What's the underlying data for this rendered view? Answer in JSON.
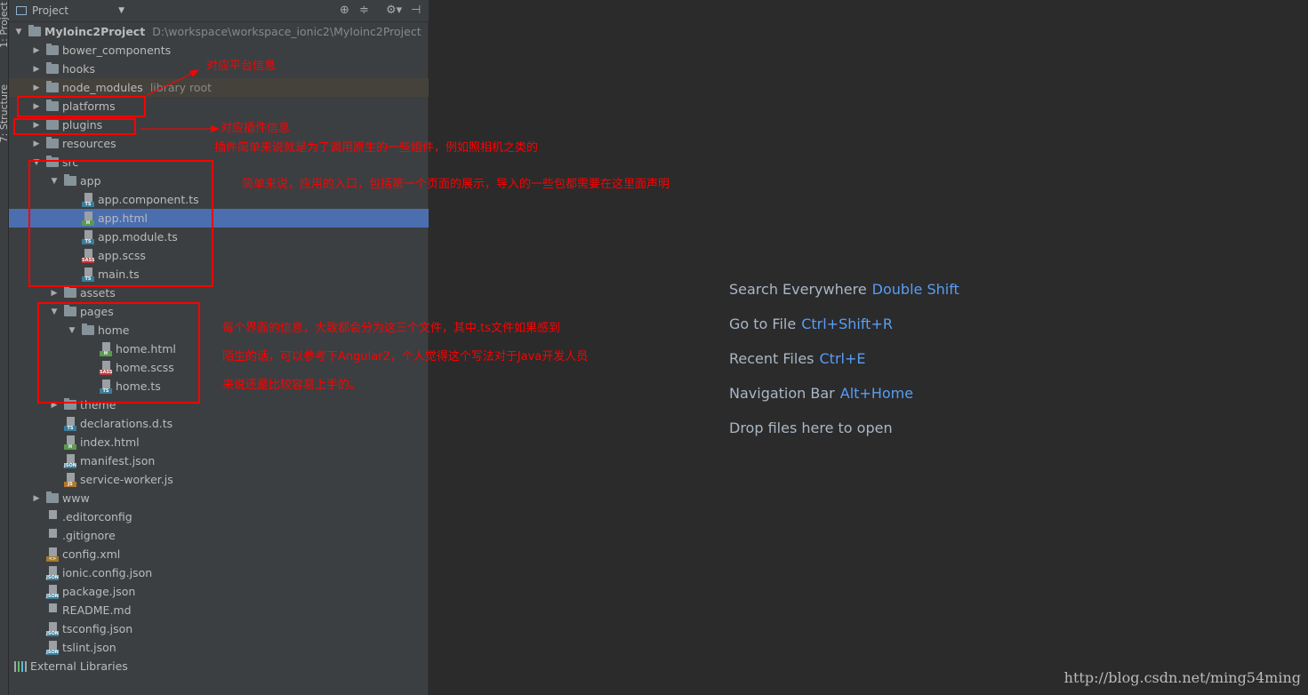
{
  "sidebar_tabs": {
    "project": "1: Project",
    "structure": "7: Structure"
  },
  "header": {
    "title": "Project"
  },
  "tree": [
    {
      "level": 0,
      "kind": "folder",
      "state": "open",
      "name": "MyIoinc2Project",
      "extra": "D:\\workspace\\workspace_ionic2\\MyIoinc2Project",
      "bold": true
    },
    {
      "level": 1,
      "kind": "folder",
      "state": "closed",
      "name": "bower_components"
    },
    {
      "level": 1,
      "kind": "folder",
      "state": "closed",
      "name": "hooks"
    },
    {
      "level": 1,
      "kind": "folder",
      "state": "closed",
      "name": "node_modules",
      "extra": "library root",
      "lib": true
    },
    {
      "level": 1,
      "kind": "folder",
      "state": "closed",
      "name": "platforms"
    },
    {
      "level": 1,
      "kind": "folder",
      "state": "closed",
      "name": "plugins"
    },
    {
      "level": 1,
      "kind": "folder",
      "state": "closed",
      "name": "resources"
    },
    {
      "level": 1,
      "kind": "folder",
      "state": "open",
      "name": "src"
    },
    {
      "level": 2,
      "kind": "folder",
      "state": "open",
      "name": "app"
    },
    {
      "level": 3,
      "kind": "file",
      "badge": "TS",
      "name": "app.component.ts"
    },
    {
      "level": 3,
      "kind": "file",
      "badge": "H",
      "name": "app.html",
      "selected": true
    },
    {
      "level": 3,
      "kind": "file",
      "badge": "TS",
      "name": "app.module.ts"
    },
    {
      "level": 3,
      "kind": "file",
      "badge": "SASS",
      "name": "app.scss"
    },
    {
      "level": 3,
      "kind": "file",
      "badge": "TS",
      "name": "main.ts"
    },
    {
      "level": 2,
      "kind": "folder",
      "state": "closed",
      "name": "assets"
    },
    {
      "level": 2,
      "kind": "folder",
      "state": "open",
      "name": "pages"
    },
    {
      "level": 3,
      "kind": "folder",
      "state": "open",
      "name": "home"
    },
    {
      "level": 4,
      "kind": "file",
      "badge": "H",
      "name": "home.html"
    },
    {
      "level": 4,
      "kind": "file",
      "badge": "SASS",
      "name": "home.scss"
    },
    {
      "level": 4,
      "kind": "file",
      "badge": "TS",
      "name": "home.ts"
    },
    {
      "level": 2,
      "kind": "folder",
      "state": "closed",
      "name": "theme"
    },
    {
      "level": 2,
      "kind": "file",
      "badge": "TS",
      "name": "declarations.d.ts"
    },
    {
      "level": 2,
      "kind": "file",
      "badge": "H",
      "name": "index.html"
    },
    {
      "level": 2,
      "kind": "file",
      "badge": "JSON",
      "name": "manifest.json"
    },
    {
      "level": 2,
      "kind": "file",
      "badge": "JS",
      "name": "service-worker.js"
    },
    {
      "level": 1,
      "kind": "folder",
      "state": "closed",
      "name": "www"
    },
    {
      "level": 1,
      "kind": "file",
      "badge": "",
      "name": ".editorconfig"
    },
    {
      "level": 1,
      "kind": "file",
      "badge": "",
      "name": ".gitignore"
    },
    {
      "level": 1,
      "kind": "file",
      "badge": "XML",
      "name": "config.xml"
    },
    {
      "level": 1,
      "kind": "file",
      "badge": "JSON",
      "name": "ionic.config.json"
    },
    {
      "level": 1,
      "kind": "file",
      "badge": "JSON",
      "name": "package.json"
    },
    {
      "level": 1,
      "kind": "file",
      "badge": "",
      "name": "README.md"
    },
    {
      "level": 1,
      "kind": "file",
      "badge": "JSON",
      "name": "tsconfig.json"
    },
    {
      "level": 1,
      "kind": "file",
      "badge": "JSON",
      "name": "tslint.json"
    },
    {
      "level": 0,
      "kind": "libs",
      "name": "External Libraries"
    }
  ],
  "badge_colors": {
    "TS": "#3d7c9a",
    "H": "#5b9a4f",
    "SASS": "#b0393b",
    "JSON": "#3d7c9a",
    "JS": "#b07a2f",
    "XML": "#a27a2e"
  },
  "annotations": {
    "platforms": "对应平台信息",
    "plugins": "对应插件信息",
    "plugins_detail": "插件简单来说就是为了调用原生的一些组件，例如照相机之类的",
    "app": "简单来说，应用的入口，包括第一个页面的展示，导入的一些包都需要在这里面声明",
    "pages_1": "每个界面的信息，大致都会分为这三个文件，其中.ts文件如果感到",
    "pages_2": "陌生的话，可以参考下Angular2，个人觉得这个写法对于Java开发人员",
    "pages_3": "来说还是比较容易上手的。",
    "color": "#ff0000"
  },
  "editor_hints": [
    {
      "label": "Search Everywhere",
      "key": "Double Shift"
    },
    {
      "label": "Go to File",
      "key": "Ctrl+Shift+R"
    },
    {
      "label": "Recent Files",
      "key": "Ctrl+E"
    },
    {
      "label": "Navigation Bar",
      "key": "Alt+Home"
    },
    {
      "label": "Drop files here to open",
      "key": ""
    }
  ],
  "watermark": "http://blog.csdn.net/ming54ming"
}
